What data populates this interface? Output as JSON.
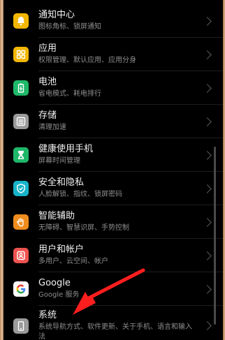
{
  "settings": {
    "items": [
      {
        "title": "通知中心",
        "subtitle": "图标角标、锁屏通知",
        "icon": "bell-icon",
        "color": "#f2b705"
      },
      {
        "title": "应用",
        "subtitle": "权限管理、默认应用、应用分身",
        "icon": "apps-grid-icon",
        "color": "#f2b705"
      },
      {
        "title": "电池",
        "subtitle": "省电模式、耗电排行",
        "icon": "battery-icon",
        "color": "#1fb86a"
      },
      {
        "title": "存储",
        "subtitle": "清理加速",
        "icon": "storage-icon",
        "color": "#9a9a9a"
      },
      {
        "title": "健康使用手机",
        "subtitle": "屏幕时间管理",
        "icon": "hourglass-icon",
        "color": "#1fb86a"
      },
      {
        "title": "安全和隐私",
        "subtitle": "人脸解锁、指纹、锁屏密码",
        "icon": "shield-icon",
        "color": "#18b3c8"
      },
      {
        "title": "智能辅助",
        "subtitle": "无障碍、智慧识屏、手势控制",
        "icon": "hand-icon",
        "color": "#f08c1e"
      },
      {
        "title": "用户和帐户",
        "subtitle": "多用户、云空间、帐户",
        "icon": "user-icon",
        "color": "#ef5350"
      },
      {
        "title": "Google",
        "subtitle": "Google 服务",
        "icon": "google-icon",
        "color": "#ffffff"
      },
      {
        "title": "系统",
        "subtitle": "系统导航方式、软件更新、关于手机、语言和输入法",
        "icon": "system-phone-icon",
        "color": "#9a9a9a"
      }
    ]
  }
}
